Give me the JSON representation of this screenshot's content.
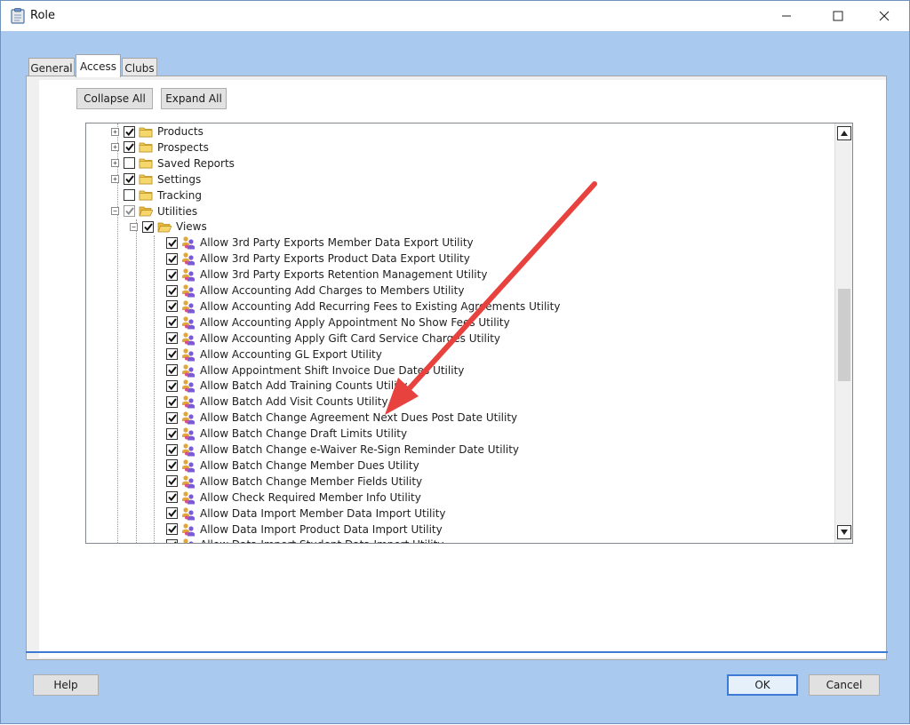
{
  "window": {
    "title": "Role"
  },
  "tabs": [
    {
      "label": "General"
    },
    {
      "label": "Access"
    },
    {
      "label": "Clubs"
    }
  ],
  "toolbar": {
    "collapse_label": "Collapse All",
    "expand_label": "Expand All"
  },
  "tree": {
    "nodes": [
      {
        "label": "Products",
        "checked": true
      },
      {
        "label": "Prospects",
        "checked": true
      },
      {
        "label": "Saved Reports",
        "checked": false
      },
      {
        "label": "Settings",
        "checked": true
      },
      {
        "label": "Tracking",
        "checked": false
      },
      {
        "label": "Utilities",
        "checked": true
      },
      {
        "label": "Views",
        "checked": true
      },
      {
        "label": "Allow 3rd Party Exports Member Data Export Utility",
        "checked": true
      },
      {
        "label": "Allow 3rd Party Exports Product Data Export Utility",
        "checked": true
      },
      {
        "label": "Allow 3rd Party Exports Retention Management Utility",
        "checked": true
      },
      {
        "label": "Allow Accounting Add Charges to Members Utility",
        "checked": true
      },
      {
        "label": "Allow Accounting Add Recurring Fees to Existing Agreements Utility",
        "checked": true
      },
      {
        "label": "Allow Accounting Apply Appointment No Show Fees Utility",
        "checked": true
      },
      {
        "label": "Allow Accounting Apply Gift Card Service Charges Utility",
        "checked": true
      },
      {
        "label": "Allow Accounting GL Export Utility",
        "checked": true
      },
      {
        "label": "Allow Appointment Shift Invoice Due Dates Utility",
        "checked": true
      },
      {
        "label": "Allow Batch Add Training Counts Utility",
        "checked": true
      },
      {
        "label": "Allow Batch Add Visit Counts Utility",
        "checked": true
      },
      {
        "label": "Allow Batch Change Agreement Next Dues Post Date Utility",
        "checked": true
      },
      {
        "label": "Allow Batch Change Draft Limits Utility",
        "checked": true
      },
      {
        "label": "Allow Batch Change e-Waiver Re-Sign Reminder Date Utility",
        "checked": true
      },
      {
        "label": "Allow Batch Change Member Dues Utility",
        "checked": true
      },
      {
        "label": "Allow Batch Change Member Fields Utility",
        "checked": true
      },
      {
        "label": "Allow Check Required Member Info Utility",
        "checked": true
      },
      {
        "label": "Allow Data Import Member Data Import Utility",
        "checked": true
      },
      {
        "label": "Allow Data Import Product Data Import Utility",
        "checked": true
      },
      {
        "label": "Allow Data Import Student Data Import Utility",
        "checked": true
      }
    ]
  },
  "footer": {
    "help_label": "Help",
    "ok_label": "OK",
    "cancel_label": "Cancel"
  },
  "colors": {
    "accent": "#3d7ad6",
    "window_bg": "#a9c9ee",
    "arrow": "#e8423f",
    "folder": "#f2c94c"
  }
}
